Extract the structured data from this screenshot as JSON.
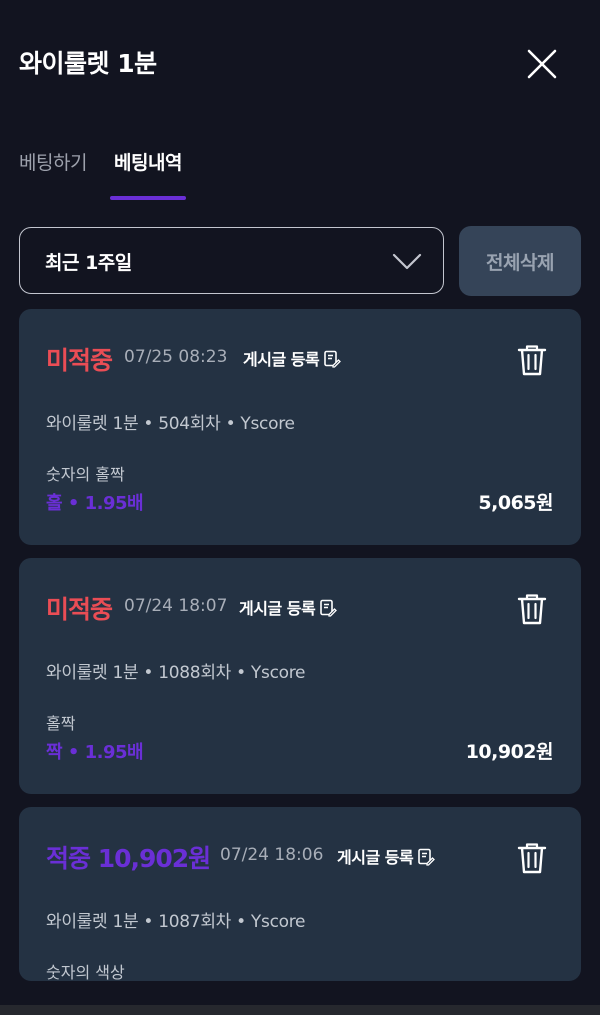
{
  "header": {
    "title": "와이룰렛 1분"
  },
  "tabs": [
    {
      "label": "베팅하기",
      "active": false
    },
    {
      "label": "베팅내역",
      "active": true
    }
  ],
  "filter": {
    "period": "최근 1주일",
    "delete_all_label": "전체삭제"
  },
  "colors": {
    "background": "#121420",
    "card": "#243243",
    "accent": "#6a2fd6",
    "miss": "#ea4d55"
  },
  "bets": [
    {
      "status": "미적중",
      "datetime": "07/25 08:23",
      "post_label": "게시글 등록",
      "game": "와이룰렛 1분 • 504회차 • Yscore",
      "bet_type": "숫자의 홀짝",
      "pick": "홀 • 1.95배",
      "amount": "5,065원"
    },
    {
      "status": "미적중",
      "datetime": "07/24 18:07",
      "post_label": "게시글 등록",
      "game": "와이룰렛 1분 • 1088회차 • Yscore",
      "bet_type": "홀짝",
      "pick": "짝 • 1.95배",
      "amount": "10,902원"
    },
    {
      "status": "적중 10,902원",
      "datetime": "07/24 18:06",
      "post_label": "게시글 등록",
      "game": "와이룰렛 1분 • 1087회차 • Yscore",
      "bet_type": "숫자의 색상"
    }
  ]
}
